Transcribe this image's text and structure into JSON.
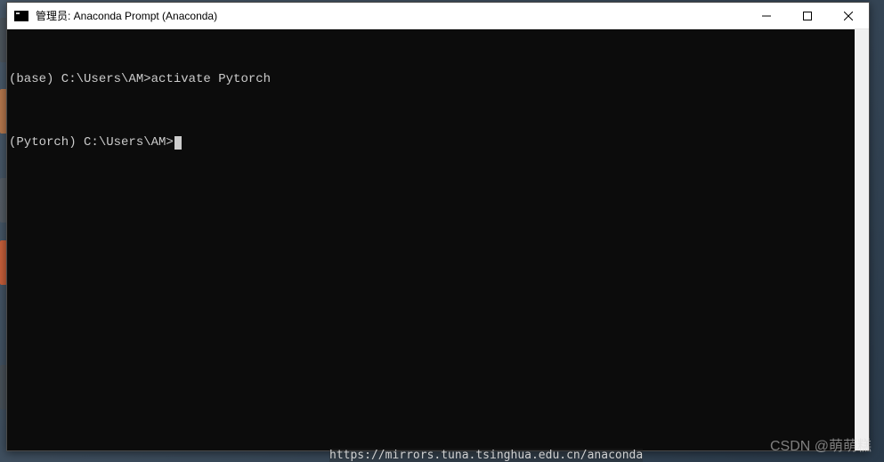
{
  "window": {
    "title": "管理员: Anaconda Prompt (Anaconda)"
  },
  "terminal": {
    "lines": [
      "(base) C:\\Users\\AM>activate Pytorch",
      "(Pytorch) C:\\Users\\AM>"
    ]
  },
  "watermark": "CSDN @萌萌糕",
  "bottom_partial": "https://mirrors.tuna.tsinghua.edu.cn/anaconda"
}
